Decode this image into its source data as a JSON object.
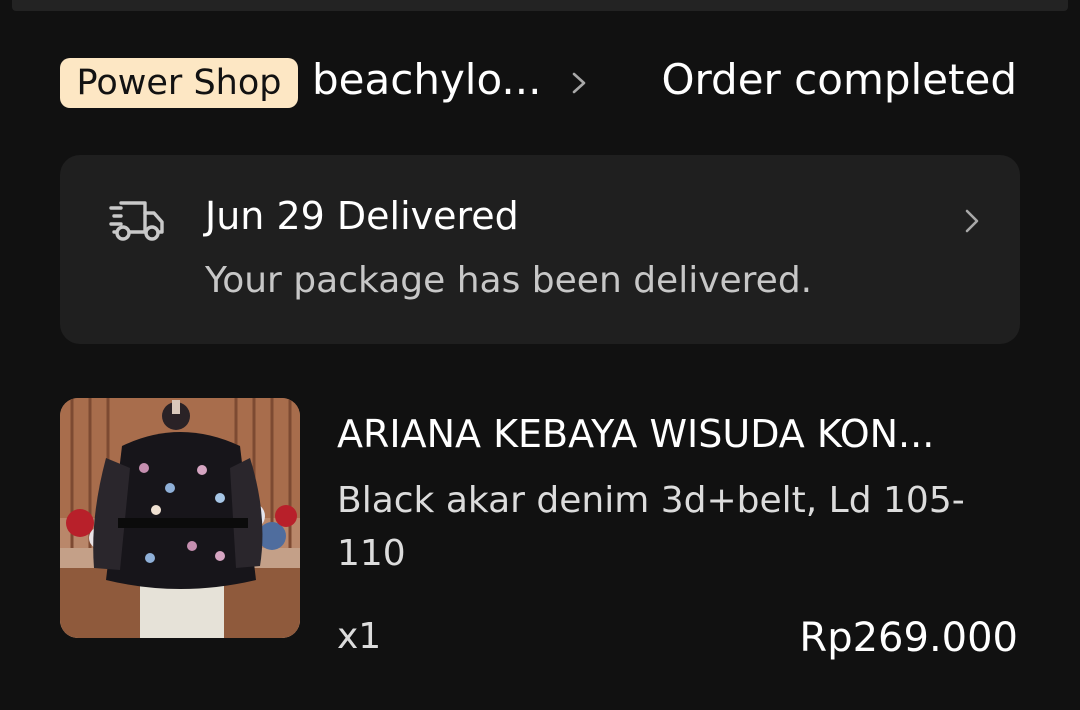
{
  "shop": {
    "badge": "Power Shop",
    "name": "beachylo...",
    "order_status": "Order completed"
  },
  "delivery": {
    "title": "Jun 29 Delivered",
    "subtitle": "Your package has been delivered."
  },
  "product": {
    "title": "ARIANA KEBAYA WISUDA KON...",
    "variant": "Black akar denim 3d+belt, Ld 105-110",
    "quantity": "x1",
    "price": "Rp269.000"
  },
  "icons": {
    "shop_chevron": "chevron-right-icon",
    "delivery": "truck-icon",
    "card_chevron": "chevron-right-icon"
  },
  "colors": {
    "background": "#111111",
    "card": "#1f1f1f",
    "badge": "#fde7c4",
    "text": "#ffffff",
    "muted": "#c7c7c7"
  }
}
